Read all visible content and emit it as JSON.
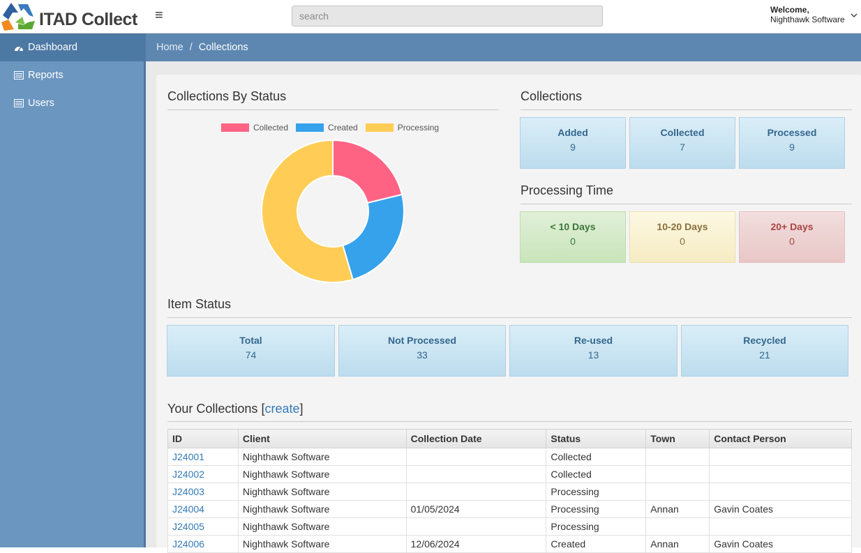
{
  "app": {
    "name": "ITAD Collect"
  },
  "search": {
    "placeholder": "search"
  },
  "user": {
    "welcome": "Welcome,",
    "name": "Nighthawk Software"
  },
  "sidebar": {
    "items": [
      {
        "label": "Dashboard",
        "icon": "dashboard-icon",
        "active": true
      },
      {
        "label": "Reports",
        "icon": "list-icon",
        "active": false
      },
      {
        "label": "Users",
        "icon": "list-icon",
        "active": false
      }
    ]
  },
  "breadcrumb": {
    "home": "Home",
    "separator": "/",
    "current": "Collections"
  },
  "collections_by_status": {
    "title": "Collections By Status"
  },
  "chart_data": {
    "type": "pie",
    "labels": [
      "Collected",
      "Created",
      "Processing"
    ],
    "values": [
      7,
      8,
      18
    ],
    "colors": [
      "#ff6384",
      "#36a2eb",
      "#ffcd56"
    ],
    "legend": "top",
    "donut": true
  },
  "collections": {
    "title": "Collections",
    "boxes": [
      {
        "label": "Added",
        "value": "9"
      },
      {
        "label": "Collected",
        "value": "7"
      },
      {
        "label": "Processed",
        "value": "9"
      }
    ]
  },
  "processing_time": {
    "title": "Processing Time",
    "boxes": [
      {
        "label": "< 10 Days",
        "value": "0",
        "color": "#dff0d8"
      },
      {
        "label": "10-20 Days",
        "value": "0",
        "color": "#fcf8e3"
      },
      {
        "label": "20+ Days",
        "value": "0",
        "color": "#f2dede"
      }
    ]
  },
  "item_status": {
    "title": "Item Status",
    "boxes": [
      {
        "label": "Total",
        "value": "74"
      },
      {
        "label": "Not Processed",
        "value": "33"
      },
      {
        "label": "Re-used",
        "value": "13"
      },
      {
        "label": "Recycled",
        "value": "21"
      }
    ]
  },
  "your_collections": {
    "title": "Your Collections",
    "bracket_open": "[",
    "create_label": "create",
    "bracket_close": "]",
    "columns": [
      "ID",
      "Client",
      "Collection Date",
      "Status",
      "Town",
      "Contact Person"
    ],
    "rows": [
      {
        "id": "J24001",
        "client": "Nighthawk Software",
        "date": "",
        "status": "Collected",
        "town": "",
        "contact": ""
      },
      {
        "id": "J24002",
        "client": "Nighthawk Software",
        "date": "",
        "status": "Collected",
        "town": "",
        "contact": ""
      },
      {
        "id": "J24003",
        "client": "Nighthawk Software",
        "date": "",
        "status": "Processing",
        "town": "",
        "contact": ""
      },
      {
        "id": "J24004",
        "client": "Nighthawk Software",
        "date": "01/05/2024",
        "status": "Processing",
        "town": "Annan",
        "contact": "Gavin Coates"
      },
      {
        "id": "J24005",
        "client": "Nighthawk Software",
        "date": "",
        "status": "Processing",
        "town": "",
        "contact": ""
      },
      {
        "id": "J24006",
        "client": "Nighthawk Software",
        "date": "12/06/2024",
        "status": "Created",
        "town": "Annan",
        "contact": "Gavin Coates"
      }
    ]
  }
}
